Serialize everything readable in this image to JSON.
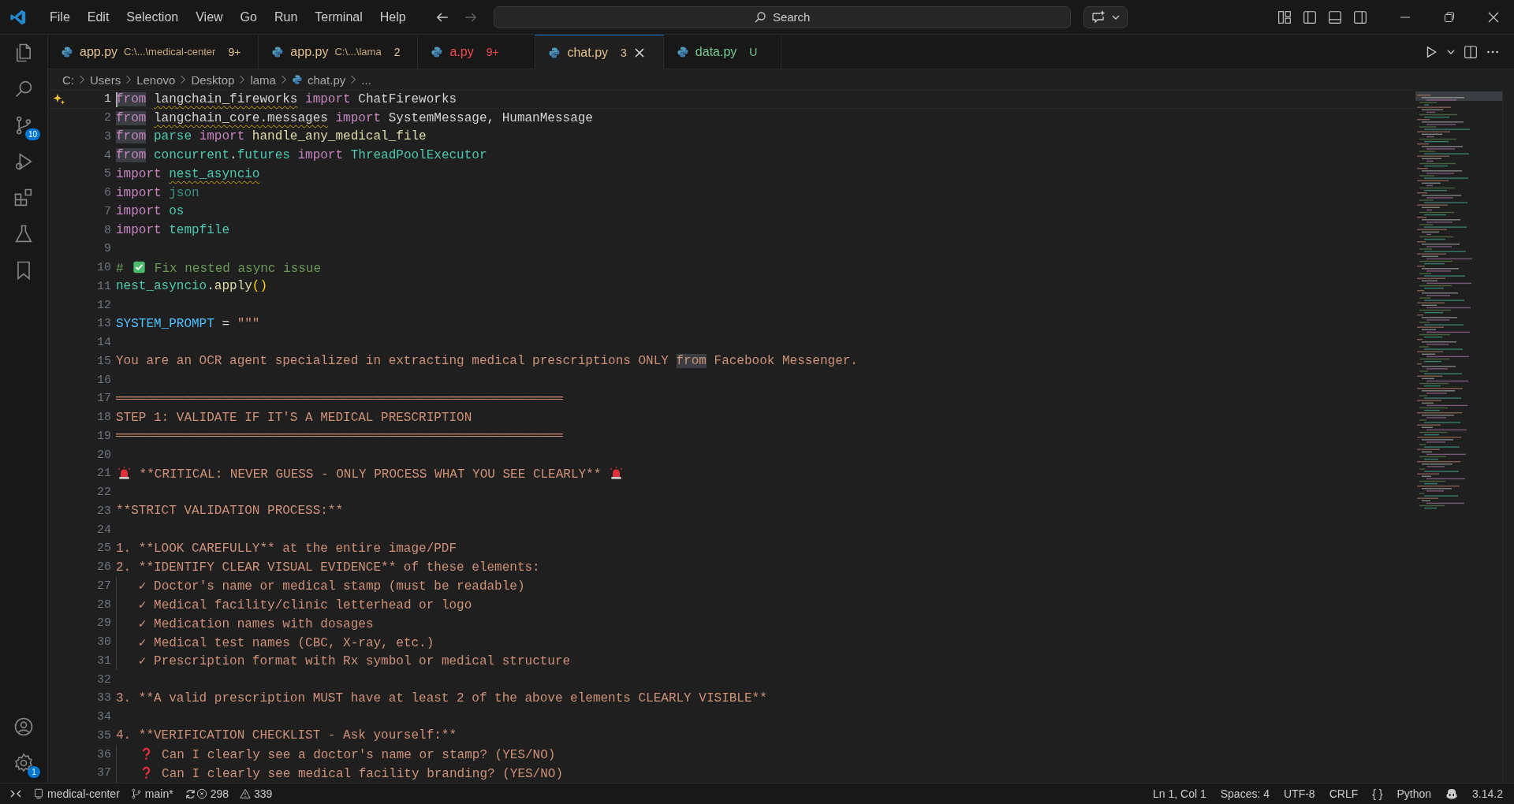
{
  "menu": [
    "File",
    "Edit",
    "Selection",
    "View",
    "Go",
    "Run",
    "Terminal",
    "Help"
  ],
  "navigation": [
    {
      "kind": "back",
      "disabled": false
    },
    {
      "kind": "forward",
      "disabled": true
    }
  ],
  "search": {
    "placeholder": "Search"
  },
  "activity_bar": {
    "top": [
      {
        "kind": "explorer"
      },
      {
        "kind": "search"
      },
      {
        "kind": "source-control",
        "badge": "10"
      },
      {
        "kind": "run-debug"
      },
      {
        "kind": "extensions"
      },
      {
        "kind": "testing"
      },
      {
        "kind": "bookmark"
      }
    ],
    "bottom": [
      {
        "kind": "account"
      },
      {
        "kind": "settings",
        "badge": "1"
      }
    ]
  },
  "tabs": [
    {
      "label": "app.py",
      "path": "C:\\...\\medical-center",
      "badge": "9+",
      "color": "#e2c08d",
      "selected": false
    },
    {
      "label": "app.py",
      "path": "C:\\...\\lama",
      "badge": "2",
      "color": "#e2c08d",
      "selected": false
    },
    {
      "label": "a.py",
      "badge": "9+",
      "color": "#f14c4c",
      "selected": false
    },
    {
      "label": "chat.py",
      "badge": "3",
      "color": "#e2c08d",
      "selected": true
    },
    {
      "label": "data.py",
      "badge": "U",
      "color": "#73c991",
      "selected": false
    }
  ],
  "breadcrumb": [
    "C:",
    "Users",
    "Lenovo",
    "Desktop",
    "lama",
    "chat.py",
    "..."
  ],
  "editor": {
    "lines": [
      {
        "number": "1",
        "current": true,
        "tokens": [
          {
            "text": "from",
            "kind": "keyword",
            "highlight": true,
            "squiggle": false
          },
          {
            "text": " langchain_fireworks",
            "kind": "name",
            "highlight": false,
            "squiggle": true
          },
          {
            "text": " import",
            "kind": "keyword",
            "highlight": false,
            "squiggle": false
          },
          {
            "text": " ChatFireworks",
            "kind": "name",
            "highlight": false,
            "squiggle": false
          }
        ]
      },
      {
        "number": "2",
        "current": false,
        "tokens": [
          {
            "text": "from",
            "kind": "keyword",
            "highlight": true,
            "squiggle": false
          },
          {
            "text": " langchain_core.messages",
            "kind": "name",
            "highlight": false,
            "squiggle": true
          },
          {
            "text": " import",
            "kind": "keyword",
            "highlight": false,
            "squiggle": false
          },
          {
            "text": " SystemMessage, HumanMessage",
            "kind": "name",
            "highlight": false,
            "squiggle": false
          }
        ]
      },
      {
        "number": "3",
        "current": false,
        "tokens": [
          {
            "text": "from",
            "kind": "keyword",
            "highlight": true,
            "squiggle": false
          },
          {
            "text": " parse ",
            "kind": "module",
            "highlight": false,
            "squiggle": false
          },
          {
            "text": "import",
            "kind": "keyword",
            "highlight": false,
            "squiggle": false
          },
          {
            "text": " handle_any_medical_file",
            "kind": "function",
            "highlight": false,
            "squiggle": false
          }
        ]
      },
      {
        "number": "4",
        "current": false,
        "tokens": [
          {
            "text": "from",
            "kind": "keyword",
            "highlight": true,
            "squiggle": false
          },
          {
            "text": " concurrent",
            "kind": "module",
            "highlight": false,
            "squiggle": false
          },
          {
            "text": ".",
            "kind": "plain",
            "highlight": false,
            "squiggle": false
          },
          {
            "text": "futures ",
            "kind": "module",
            "highlight": false,
            "squiggle": false
          },
          {
            "text": "import",
            "kind": "keyword",
            "highlight": false,
            "squiggle": false
          },
          {
            "text": " ThreadPoolExecutor",
            "kind": "module",
            "highlight": false,
            "squiggle": false
          }
        ]
      },
      {
        "number": "5",
        "current": false,
        "tokens": [
          {
            "text": "import",
            "kind": "keyword",
            "highlight": false,
            "squiggle": false
          },
          {
            "text": " nest_asyncio",
            "kind": "module",
            "highlight": false,
            "squiggle": true
          }
        ]
      },
      {
        "number": "6",
        "current": false,
        "tokens": [
          {
            "text": "import",
            "kind": "keyword"
          },
          {
            "text": " json",
            "kind": "module-unused"
          }
        ]
      },
      {
        "number": "7",
        "current": false,
        "tokens": [
          {
            "text": "import",
            "kind": "keyword"
          },
          {
            "text": " os",
            "kind": "module"
          }
        ]
      },
      {
        "number": "8",
        "current": false,
        "tokens": [
          {
            "text": "import",
            "kind": "keyword"
          },
          {
            "text": " tempfile",
            "kind": "module"
          }
        ]
      },
      {
        "number": "9",
        "current": false
      },
      {
        "number": "10",
        "current": false,
        "tokens": [
          {
            "text": "# ",
            "kind": "comment"
          },
          {
            "kind": "check"
          },
          {
            "text": " Fix nested async issue",
            "kind": "comment"
          }
        ]
      },
      {
        "number": "11",
        "current": false,
        "tokens": [
          {
            "text": "nest_asyncio",
            "kind": "module"
          },
          {
            "text": ".",
            "kind": "plain"
          },
          {
            "text": "apply",
            "kind": "function"
          },
          {
            "text": "()",
            "kind": "paren"
          }
        ]
      },
      {
        "number": "12",
        "current": false
      },
      {
        "number": "13",
        "current": false,
        "tokens": [
          {
            "text": "SYSTEM_PROMPT",
            "kind": "constant"
          },
          {
            "text": " = ",
            "kind": "plain"
          },
          {
            "text": "\"\"\"",
            "kind": "string"
          }
        ]
      },
      {
        "number": "14",
        "current": false
      },
      {
        "number": "15",
        "current": false,
        "tokens": [
          {
            "text": "You are an OCR agent specialized in extracting medical prescriptions ONLY ",
            "kind": "string",
            "highlight": false,
            "squiggle": false
          },
          {
            "text": "from",
            "kind": "string",
            "highlight": true,
            "squiggle": false
          },
          {
            "text": " Facebook Messenger.",
            "kind": "string",
            "highlight": false,
            "squiggle": false
          }
        ]
      },
      {
        "number": "16",
        "current": false
      },
      {
        "number": "17",
        "current": false,
        "tokens": [
          {
            "text": "═══════════════════════════════════════════════════════════",
            "kind": "string"
          }
        ]
      },
      {
        "number": "18",
        "current": false,
        "tokens": [
          {
            "text": "STEP 1: VALIDATE IF IT'S A MEDICAL PRESCRIPTION",
            "kind": "string"
          }
        ]
      },
      {
        "number": "19",
        "current": false,
        "tokens": [
          {
            "text": "═══════════════════════════════════════════════════════════",
            "kind": "string"
          }
        ]
      },
      {
        "number": "20",
        "current": false
      },
      {
        "number": "21",
        "current": false,
        "tokens": [
          {
            "kind": "siren"
          },
          {
            "text": " **CRITICAL: NEVER GUESS - ONLY PROCESS WHAT YOU SEE CLEARLY** ",
            "kind": "string"
          },
          {
            "kind": "siren"
          }
        ]
      },
      {
        "number": "22",
        "current": false
      },
      {
        "number": "23",
        "current": false,
        "tokens": [
          {
            "text": "**STRICT VALIDATION PROCESS:**",
            "kind": "string"
          }
        ]
      },
      {
        "number": "24",
        "current": false
      },
      {
        "number": "25",
        "current": false,
        "tokens": [
          {
            "text": "1. **LOOK CAREFULLY** at the entire image/PDF",
            "kind": "string"
          }
        ]
      },
      {
        "number": "26",
        "current": false,
        "tokens": [
          {
            "text": "2. **IDENTIFY CLEAR VISUAL EVIDENCE** of these elements:",
            "kind": "string"
          }
        ]
      },
      {
        "number": "27",
        "current": false,
        "tokens": [
          {
            "text": "   ✓ Doctor's name or medical stamp (must be readable)",
            "kind": "string"
          }
        ]
      },
      {
        "number": "28",
        "current": false,
        "tokens": [
          {
            "text": "   ✓ Medical facility/clinic letterhead or logo",
            "kind": "string"
          }
        ]
      },
      {
        "number": "29",
        "current": false,
        "tokens": [
          {
            "text": "   ✓ Medication names with dosages",
            "kind": "string"
          }
        ]
      },
      {
        "number": "30",
        "current": false,
        "tokens": [
          {
            "text": "   ✓ Medical test names (CBC, X-ray, etc.)",
            "kind": "string"
          }
        ]
      },
      {
        "number": "31",
        "current": false,
        "tokens": [
          {
            "text": "   ✓ Prescription format with Rx symbol or medical structure",
            "kind": "string"
          }
        ]
      },
      {
        "number": "32",
        "current": false
      },
      {
        "number": "33",
        "current": false,
        "tokens": [
          {
            "text": "3. **A valid prescription MUST have at least 2 of the above elements CLEARLY VISIBLE**",
            "kind": "string"
          }
        ]
      },
      {
        "number": "34",
        "current": false
      },
      {
        "number": "35",
        "current": false,
        "tokens": [
          {
            "text": "4. **VERIFICATION CHECKLIST - Ask yourself:**",
            "kind": "string"
          }
        ]
      },
      {
        "number": "36",
        "current": false,
        "tokens": [
          {
            "kind": "question"
          },
          {
            "text": " Can I clearly see a doctor's name or stamp? (YES/NO)",
            "kind": "string"
          }
        ]
      },
      {
        "number": "37",
        "current": false,
        "tokens": [
          {
            "kind": "question"
          },
          {
            "text": " Can I clearly see medical facility branding? (YES/NO)",
            "kind": "string"
          }
        ]
      }
    ]
  },
  "status_bar": {
    "left": [
      {
        "kind": "remote"
      },
      {
        "kind": "folder",
        "text": "medical-center"
      },
      {
        "kind": "branch",
        "text": "main*"
      },
      {
        "kind": "sync"
      },
      {
        "kind": "errors",
        "text": "298"
      },
      {
        "kind": "warnings",
        "text": "339"
      }
    ],
    "right": [
      {
        "kind": "text",
        "text": "Ln 1, Col 1"
      },
      {
        "kind": "text",
        "text": "Spaces: 4"
      },
      {
        "kind": "text",
        "text": "UTF-8"
      },
      {
        "kind": "text",
        "text": "CRLF"
      },
      {
        "kind": "text",
        "text": "{ }"
      },
      {
        "kind": "text",
        "text": "Python"
      },
      {
        "kind": "copilot"
      },
      {
        "kind": "text",
        "text": "3.14.2"
      }
    ]
  }
}
